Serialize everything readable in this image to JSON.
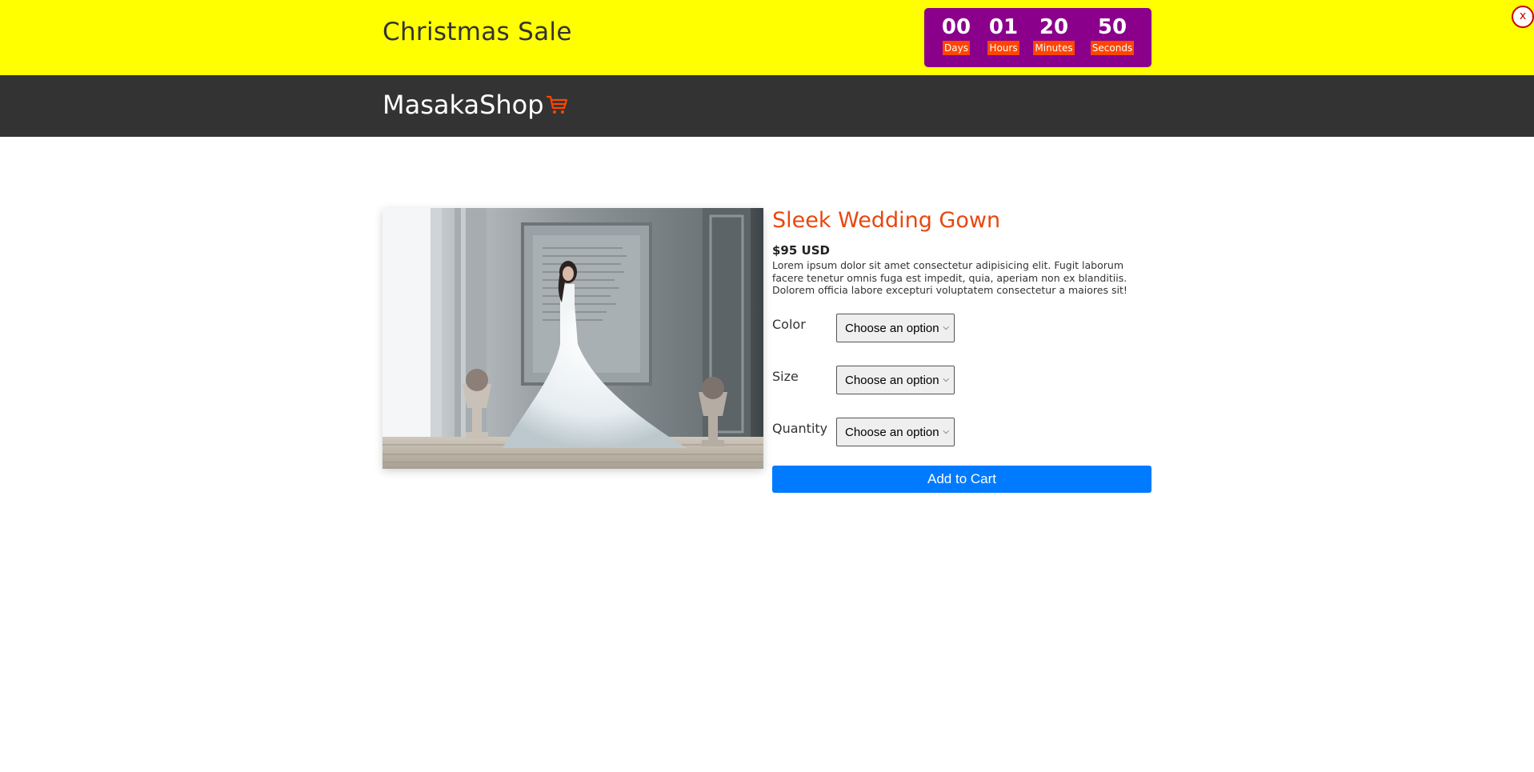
{
  "promo": {
    "title": "Christmas Sale",
    "countdown": [
      {
        "value": "00",
        "label": "Days"
      },
      {
        "value": "01",
        "label": "Hours"
      },
      {
        "value": "20",
        "label": "Minutes"
      },
      {
        "value": "50",
        "label": "Seconds"
      }
    ],
    "close_label": "x",
    "colors": {
      "banner": "#ffff00",
      "countdown_bg": "#8b008b",
      "label_bg": "#ff4500"
    }
  },
  "navbar": {
    "brand": "MasakaShop",
    "cart_icon": "shopping-cart-icon",
    "colors": {
      "bg": "#333333",
      "icon": "#ff4500"
    }
  },
  "product": {
    "title": "Sleek Wedding Gown",
    "price": "$95 USD",
    "description": "Lorem ipsum dolor sit amet consectetur adipisicing elit. Fugit laborum facere tenetur omnis fuga est impedit, quia, aperiam non ex blanditiis. Dolorem officia labore excepturi voluptatem consectetur a maiores sit!",
    "options": [
      {
        "label": "Color",
        "value": "Choose an option"
      },
      {
        "label": "Size",
        "value": "Choose an option"
      },
      {
        "label": "Quantity",
        "value": "Choose an option"
      }
    ],
    "add_to_cart": "Add to Cart",
    "colors": {
      "title": "#e8470f",
      "button": "#007bff"
    }
  }
}
